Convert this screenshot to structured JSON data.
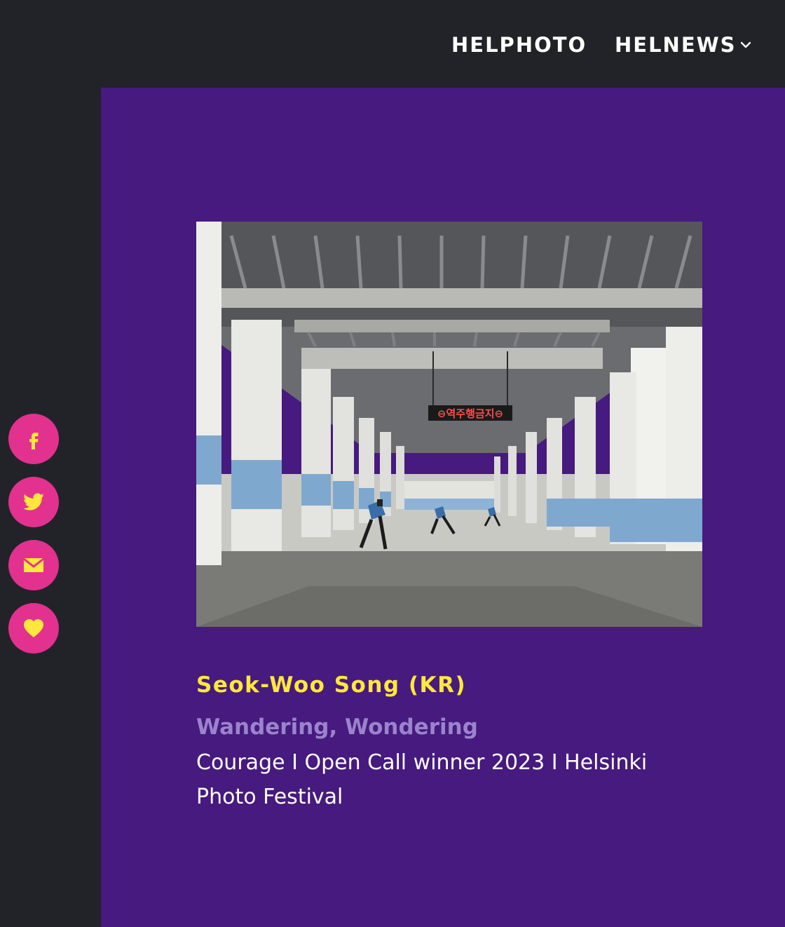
{
  "nav": {
    "items": [
      {
        "label": "HELPHOTO"
      },
      {
        "label": "HELNEWS",
        "has_dropdown": true
      }
    ]
  },
  "share_buttons": [
    {
      "icon": "facebook-icon"
    },
    {
      "icon": "twitter-icon"
    },
    {
      "icon": "email-icon"
    },
    {
      "icon": "heart-icon"
    }
  ],
  "artwork": {
    "title": "Seok-Woo Song (KR)",
    "subtitle": "Wandering, Wondering",
    "description": "Courage I Open Call winner 2023 I Helsinki Photo Festival",
    "photo_sign_text": "⊖역주행금지⊖"
  },
  "colors": {
    "background": "#222328",
    "panel": "#461a7e",
    "title": "#ffe83b",
    "subtitle": "#9a84cb",
    "share_button": "#e2318f",
    "share_icon": "#ffe83b"
  }
}
